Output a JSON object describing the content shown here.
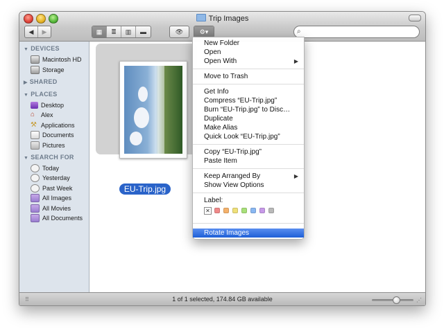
{
  "window": {
    "title": "Trip Images"
  },
  "toolbar": {
    "back_glyph": "◀",
    "forward_glyph": "▶",
    "view_icon_glyph": "▦",
    "view_list_glyph": "≣",
    "view_columns_glyph": "▥",
    "view_coverflow_glyph": "▬",
    "quicklook_glyph": "👁",
    "action_glyph": "⚙▾",
    "search_placeholder": "",
    "search_glyph": "⌕"
  },
  "sidebar": {
    "devices_header": "DEVICES",
    "devices": [
      {
        "label": "Macintosh HD",
        "icon": "hard-disk-icon"
      },
      {
        "label": "Storage",
        "icon": "hard-disk-icon"
      }
    ],
    "shared_header": "SHARED",
    "places_header": "PLACES",
    "places": [
      {
        "label": "Desktop",
        "icon": "desktop-icon"
      },
      {
        "label": "Alex",
        "icon": "home-icon"
      },
      {
        "label": "Applications",
        "icon": "applications-icon"
      },
      {
        "label": "Documents",
        "icon": "documents-icon"
      },
      {
        "label": "Pictures",
        "icon": "pictures-icon"
      }
    ],
    "search_header": "SEARCH FOR",
    "searches": [
      {
        "label": "Today",
        "icon": "clock-icon"
      },
      {
        "label": "Yesterday",
        "icon": "clock-icon"
      },
      {
        "label": "Past Week",
        "icon": "clock-icon"
      },
      {
        "label": "All Images",
        "icon": "smart-folder-icon"
      },
      {
        "label": "All Movies",
        "icon": "smart-folder-icon"
      },
      {
        "label": "All Documents",
        "icon": "smart-folder-icon"
      }
    ]
  },
  "file": {
    "name": "EU-Trip.jpg"
  },
  "context_menu": {
    "items": [
      {
        "label": "New Folder"
      },
      {
        "label": "Open"
      },
      {
        "label": "Open With",
        "submenu": "▶"
      },
      {
        "label": "Move to Trash"
      },
      {
        "label": "Get Info"
      },
      {
        "label": "Compress “EU-Trip.jpg”"
      },
      {
        "label": "Burn “EU-Trip.jpg” to Disc…"
      },
      {
        "label": "Duplicate"
      },
      {
        "label": "Make Alias"
      },
      {
        "label": "Quick Look “EU-Trip.jpg”"
      },
      {
        "label": "Copy “EU-Trip.jpg”"
      },
      {
        "label": "Paste Item"
      },
      {
        "label": "Keep Arranged By",
        "submenu": "▶"
      },
      {
        "label": "Show View Options"
      },
      {
        "label": "Label:"
      },
      {
        "label": "Rotate Images"
      }
    ],
    "label_none_glyph": "✕",
    "label_colors": [
      "#f08a8a",
      "#f5b26b",
      "#efe07a",
      "#a8e07a",
      "#8ab8f2",
      "#c79ae8",
      "#b9b9b9"
    ]
  },
  "status": {
    "text": "1 of 1 selected, 174.84 GB available",
    "grip_glyph": "⠿",
    "resize_glyph": "⋰"
  }
}
